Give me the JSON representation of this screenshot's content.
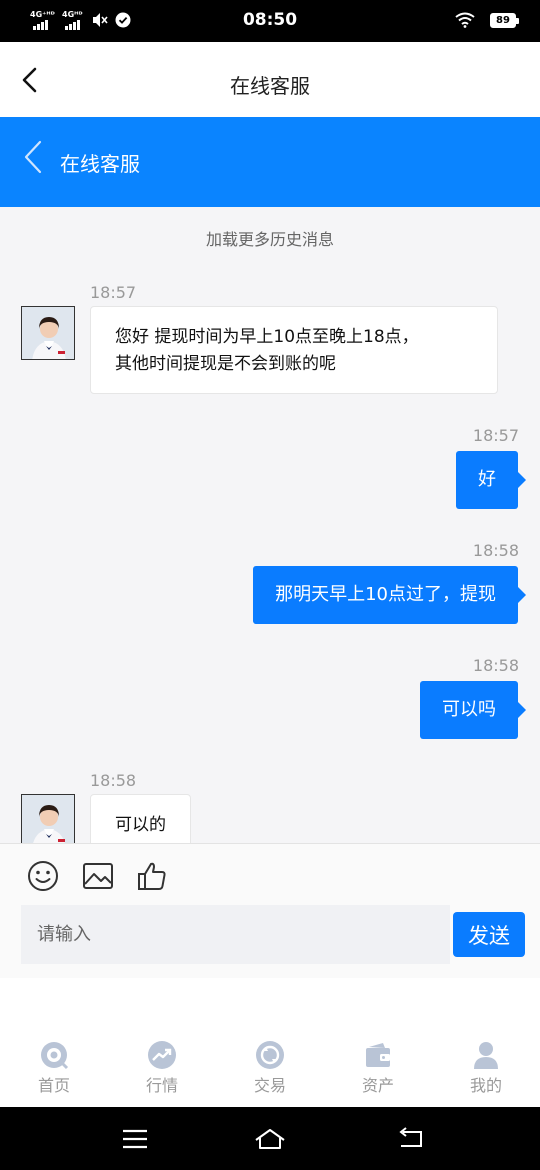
{
  "status_bar": {
    "time": "08:50",
    "net1": "4G⁺ᴴᴰ",
    "net2": "4Gᴴᴰ",
    "battery": "89"
  },
  "top_nav": {
    "title": "在线客服"
  },
  "chat_header": {
    "title": "在线客服"
  },
  "chat": {
    "load_more": "加载更多历史消息",
    "messages": [
      {
        "side": "left",
        "time": "18:57",
        "lines": [
          "您好 提现时间为早上10点至晚上18点，",
          "其他时间提现是不会到账的呢"
        ]
      },
      {
        "side": "right",
        "time": "18:57",
        "text": "好"
      },
      {
        "side": "right",
        "time": "18:58",
        "text": "那明天早上10点过了，提现"
      },
      {
        "side": "right",
        "time": "18:58",
        "text": "可以吗"
      },
      {
        "side": "left",
        "time": "18:58",
        "lines": [
          "可以的"
        ]
      }
    ]
  },
  "composer": {
    "placeholder": "请输入",
    "send_label": "发送",
    "tools": [
      "emoji-icon",
      "image-icon",
      "thumbs-up-icon"
    ]
  },
  "tabbar": {
    "items": [
      {
        "label": "首页",
        "icon": "home-icon"
      },
      {
        "label": "行情",
        "icon": "trend-icon"
      },
      {
        "label": "交易",
        "icon": "exchange-icon"
      },
      {
        "label": "资产",
        "icon": "wallet-icon"
      },
      {
        "label": "我的",
        "icon": "user-icon"
      }
    ]
  },
  "colors": {
    "accent": "#0a84ff",
    "bubble": "#0a7cff",
    "chat_bg": "#f5f5f7",
    "tab_inactive": "#9a9a9a"
  }
}
